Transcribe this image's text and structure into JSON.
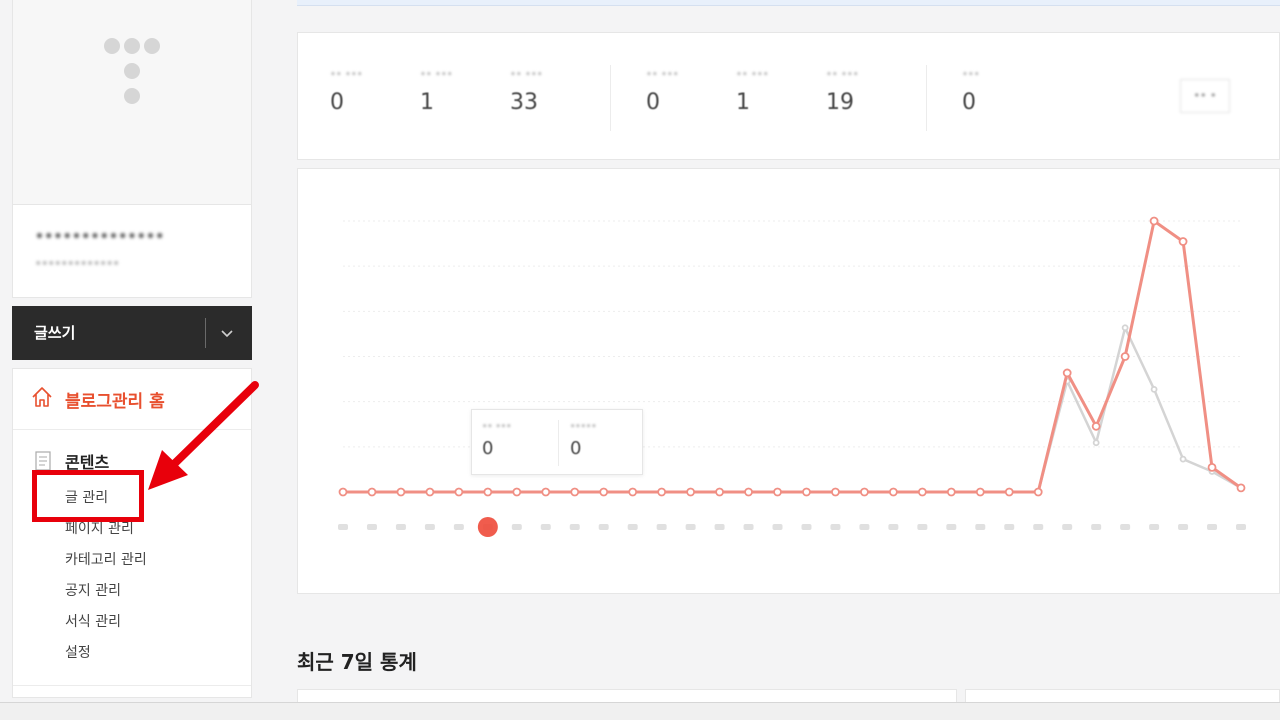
{
  "sidebar": {
    "profile": {
      "name": "••••••••••••••",
      "url": "•••••••••••••"
    },
    "write_label": "글쓰기",
    "home_label": "블로그관리 홈",
    "section_title": "콘텐츠",
    "submenu": [
      "글 관리",
      "페이지 관리",
      "카테고리 관리",
      "공지 관리",
      "서식 관리",
      "설정"
    ]
  },
  "stats": {
    "group1": [
      {
        "label": "•• •••",
        "value": "0"
      },
      {
        "label": "•• •••",
        "value": "1"
      },
      {
        "label": "•• •••",
        "value": "33"
      }
    ],
    "group2": [
      {
        "label": "•• •••",
        "value": "0"
      },
      {
        "label": "•• •••",
        "value": "1"
      },
      {
        "label": "•• •••",
        "value": "19"
      }
    ],
    "group3": [
      {
        "label": "•••",
        "value": "0"
      }
    ],
    "more_label": "•• •"
  },
  "tooltip": {
    "left": {
      "label": "•• •••",
      "value": "0"
    },
    "right": {
      "label": "•••••",
      "value": "0"
    }
  },
  "chart_data": {
    "type": "line",
    "series": [
      {
        "values": [
          0,
          0,
          0,
          0,
          0,
          0,
          0,
          0,
          0,
          0,
          0,
          0,
          0,
          0,
          0,
          0,
          0,
          0,
          0,
          0,
          0,
          0,
          0,
          0,
          0,
          29,
          16,
          33,
          66,
          61,
          6,
          1
        ]
      },
      {
        "values": [
          0,
          0,
          0,
          0,
          0,
          0,
          0,
          0,
          0,
          0,
          0,
          0,
          0,
          0,
          0,
          0,
          0,
          0,
          0,
          0,
          0,
          0,
          0,
          0,
          0,
          27,
          12,
          40,
          25,
          8,
          5,
          1
        ]
      }
    ],
    "ylim": [
      0,
      66
    ],
    "colors": {
      "series1": "#f08f84",
      "series2": "#d4d4d4",
      "highlight": "#ee4a3a"
    },
    "highlight_index": 5
  },
  "section_heading": "최근 7일 통계"
}
